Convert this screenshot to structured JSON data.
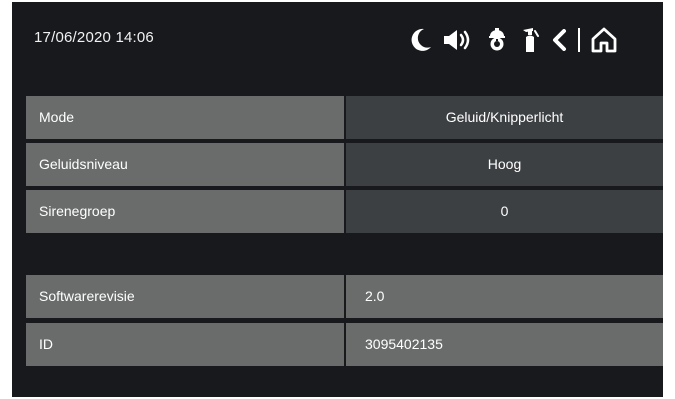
{
  "status_bar": {
    "datetime": "17/06/2020  14:06"
  },
  "toolbar": {
    "icons": [
      "moon-icon",
      "speaker-icon",
      "smoke-detector-icon",
      "fire-extinguisher-icon",
      "back-icon",
      "home-icon"
    ]
  },
  "settings": [
    {
      "label": "Mode",
      "value": "Geluid/Knipperlicht"
    },
    {
      "label": "Geluidsniveau",
      "value": "Hoog"
    },
    {
      "label": "Sirenegroep",
      "value": "0"
    }
  ],
  "info": [
    {
      "label": "Softwarerevisie",
      "value": "2.0"
    },
    {
      "label": "ID",
      "value": "3095402135"
    }
  ],
  "colors": {
    "background": "#17191d",
    "label_cell": "#6a6c6c",
    "value_cell": "#3d4043",
    "text": "#ffffff"
  }
}
